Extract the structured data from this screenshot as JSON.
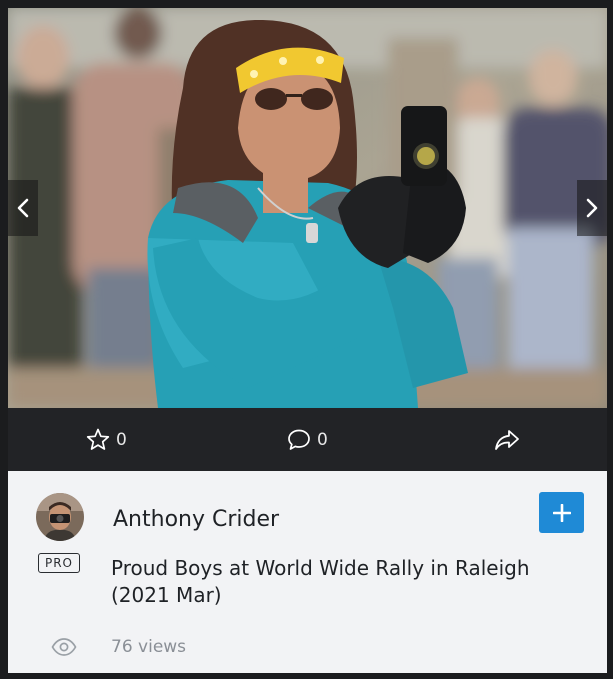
{
  "actions": {
    "likes_icon": "star-icon",
    "likes_count": "0",
    "comments_icon": "comment-icon",
    "comments_count": "0",
    "share_icon": "share-icon"
  },
  "photo_nav": {
    "prev_icon": "chevron-left-icon",
    "next_icon": "chevron-right-icon"
  },
  "author": {
    "name": "Anthony Crider",
    "badge": "PRO"
  },
  "photo_title": "Proud Boys at World Wide Rally in Raleigh (2021 Mar)",
  "stats": {
    "views_icon": "eye-icon",
    "views": "76 views"
  },
  "follow_button": {
    "icon": "plus-icon"
  },
  "colors": {
    "page_bg": "#1b1c1e",
    "card_bg": "#f2f3f5",
    "action_bar_bg": "#222326",
    "accent_blue": "#1f8ad6",
    "muted_text": "#8a8f96"
  }
}
